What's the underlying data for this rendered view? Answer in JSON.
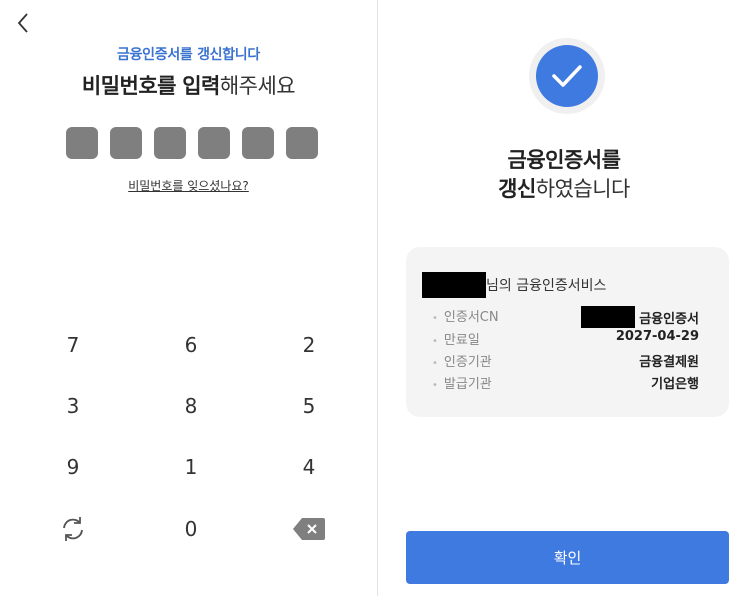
{
  "left": {
    "subtitle": "금융인증서를 갱신합니다",
    "title_bold_1": "비밀번호를",
    "title_bold_2": "입력",
    "title_light": "해주세요",
    "forgot_link": "비밀번호를 잊으셨나요?",
    "keypad": {
      "row1": [
        "7",
        "6",
        "2"
      ],
      "row2": [
        "3",
        "8",
        "5"
      ],
      "row3": [
        "9",
        "1",
        "4"
      ],
      "row4_center": "0"
    }
  },
  "right": {
    "done_line1": "금융인증서를",
    "done_bold": "갱신",
    "done_light": "하였습니다",
    "card": {
      "heading_suffix": "님의 금융인증서비스",
      "rows": [
        {
          "label": "인증서CN",
          "value": "금융인증서"
        },
        {
          "label": "만료일",
          "value": "2027-04-29"
        },
        {
          "label": "인증기관",
          "value": "금융결제원"
        },
        {
          "label": "발급기관",
          "value": "기업은행"
        }
      ]
    },
    "confirm_label": "확인"
  },
  "colors": {
    "accent": "#3f7ae0",
    "subtitle": "#3b73d0"
  }
}
